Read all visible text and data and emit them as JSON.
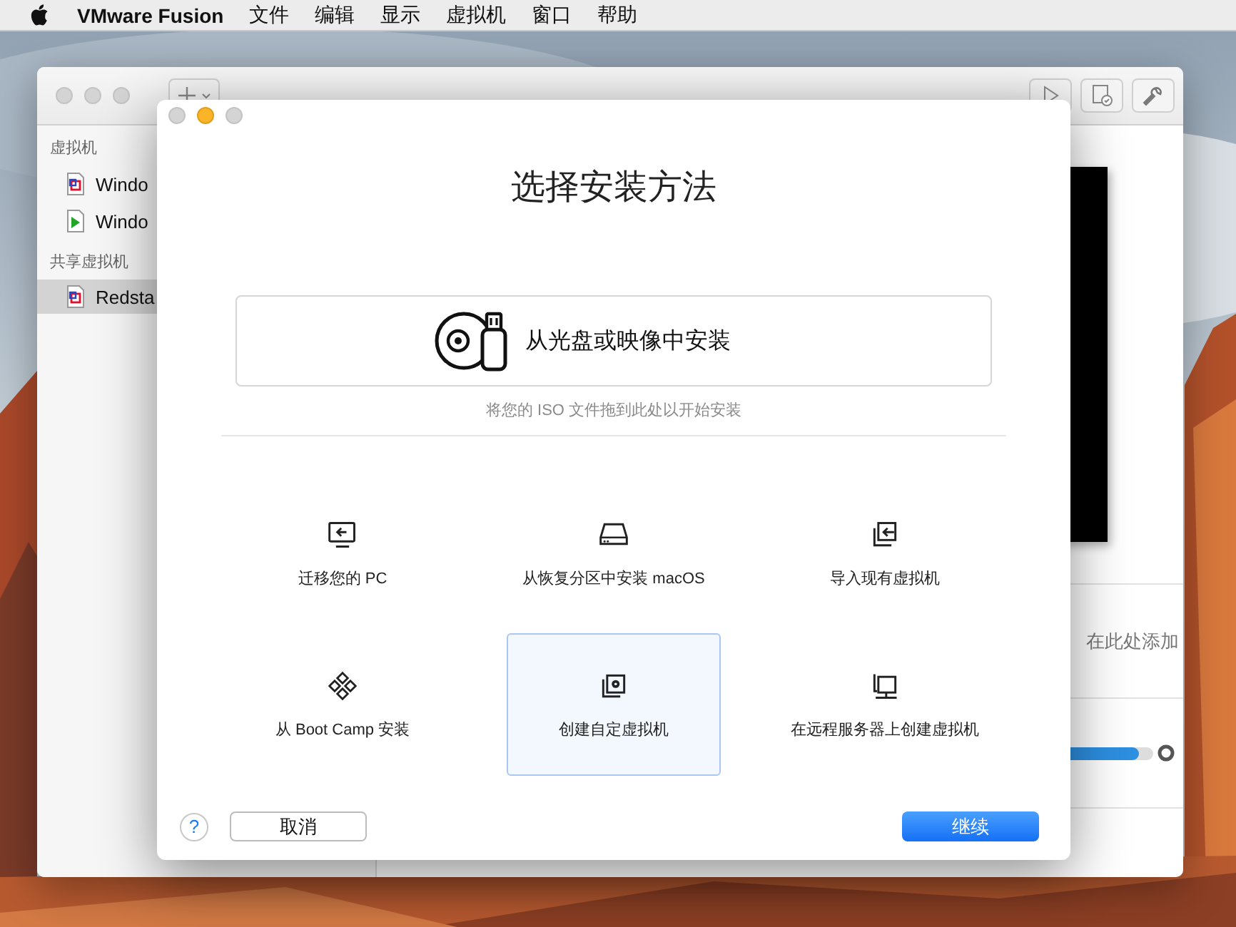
{
  "menubar": {
    "app": "VMware Fusion",
    "menus": [
      "文件",
      "编辑",
      "显示",
      "虚拟机",
      "窗口",
      "帮助"
    ]
  },
  "library": {
    "sections": [
      {
        "title": "虚拟机",
        "items": [
          {
            "name": "Windo",
            "kind": "suspended",
            "selected": false
          },
          {
            "name": "Windo",
            "kind": "running",
            "selected": false
          }
        ]
      },
      {
        "title": "共享虚拟机",
        "items": [
          {
            "name": "Redsta",
            "kind": "suspended",
            "selected": true
          }
        ]
      }
    ],
    "notes_placeholder": "在此处添加",
    "slider": {
      "level": 0.97
    }
  },
  "dialog": {
    "title": "选择安装方法",
    "primary": {
      "label": "从光盘或映像中安装",
      "hint": "将您的 ISO 文件拖到此处以开始安装"
    },
    "options": [
      {
        "label": "迁移您的 PC",
        "kind": "migrate",
        "selected": false
      },
      {
        "label": "从恢复分区中安装 macOS",
        "kind": "recovery",
        "selected": false
      },
      {
        "label": "导入现有虚拟机",
        "kind": "import",
        "selected": false
      },
      {
        "label": "从 Boot Camp 安装",
        "kind": "bootcamp",
        "selected": false
      },
      {
        "label": "创建自定虚拟机",
        "kind": "custom",
        "selected": true
      },
      {
        "label": "在远程服务器上创建虚拟机",
        "kind": "remote",
        "selected": false
      }
    ],
    "help": "?",
    "cancel": "取消",
    "continue": "继续"
  }
}
